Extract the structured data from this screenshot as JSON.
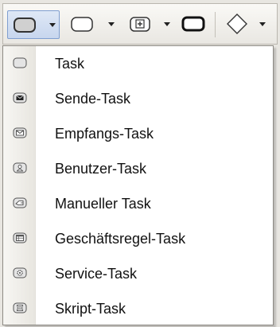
{
  "toolbar": {
    "buttons": [
      {
        "icon": "task-shape-icon",
        "state": "active"
      },
      {
        "icon": "subprocess-shape-icon",
        "state": "normal"
      },
      {
        "icon": "collapsed-subprocess-icon",
        "state": "normal"
      },
      {
        "icon": "call-activity-icon",
        "state": "normal"
      },
      {
        "icon": "gateway-diamond-icon",
        "state": "normal"
      }
    ]
  },
  "menu": {
    "items": [
      {
        "label": "Task",
        "icon": "task-icon"
      },
      {
        "label": "Sende-Task",
        "icon": "send-task-icon"
      },
      {
        "label": "Empfangs-Task",
        "icon": "receive-task-icon"
      },
      {
        "label": "Benutzer-Task",
        "icon": "user-task-icon"
      },
      {
        "label": "Manueller Task",
        "icon": "manual-task-icon"
      },
      {
        "label": "Geschäftsregel-Task",
        "icon": "business-rule-task-icon"
      },
      {
        "label": "Service-Task",
        "icon": "service-task-icon"
      },
      {
        "label": "Skript-Task",
        "icon": "script-task-icon"
      }
    ]
  },
  "colors": {
    "active_button_bg": "#c7d6ee",
    "active_button_border": "#7f9ed0",
    "menu_bg": "#ffffff",
    "gutter_bg": "#ebe9e4"
  }
}
